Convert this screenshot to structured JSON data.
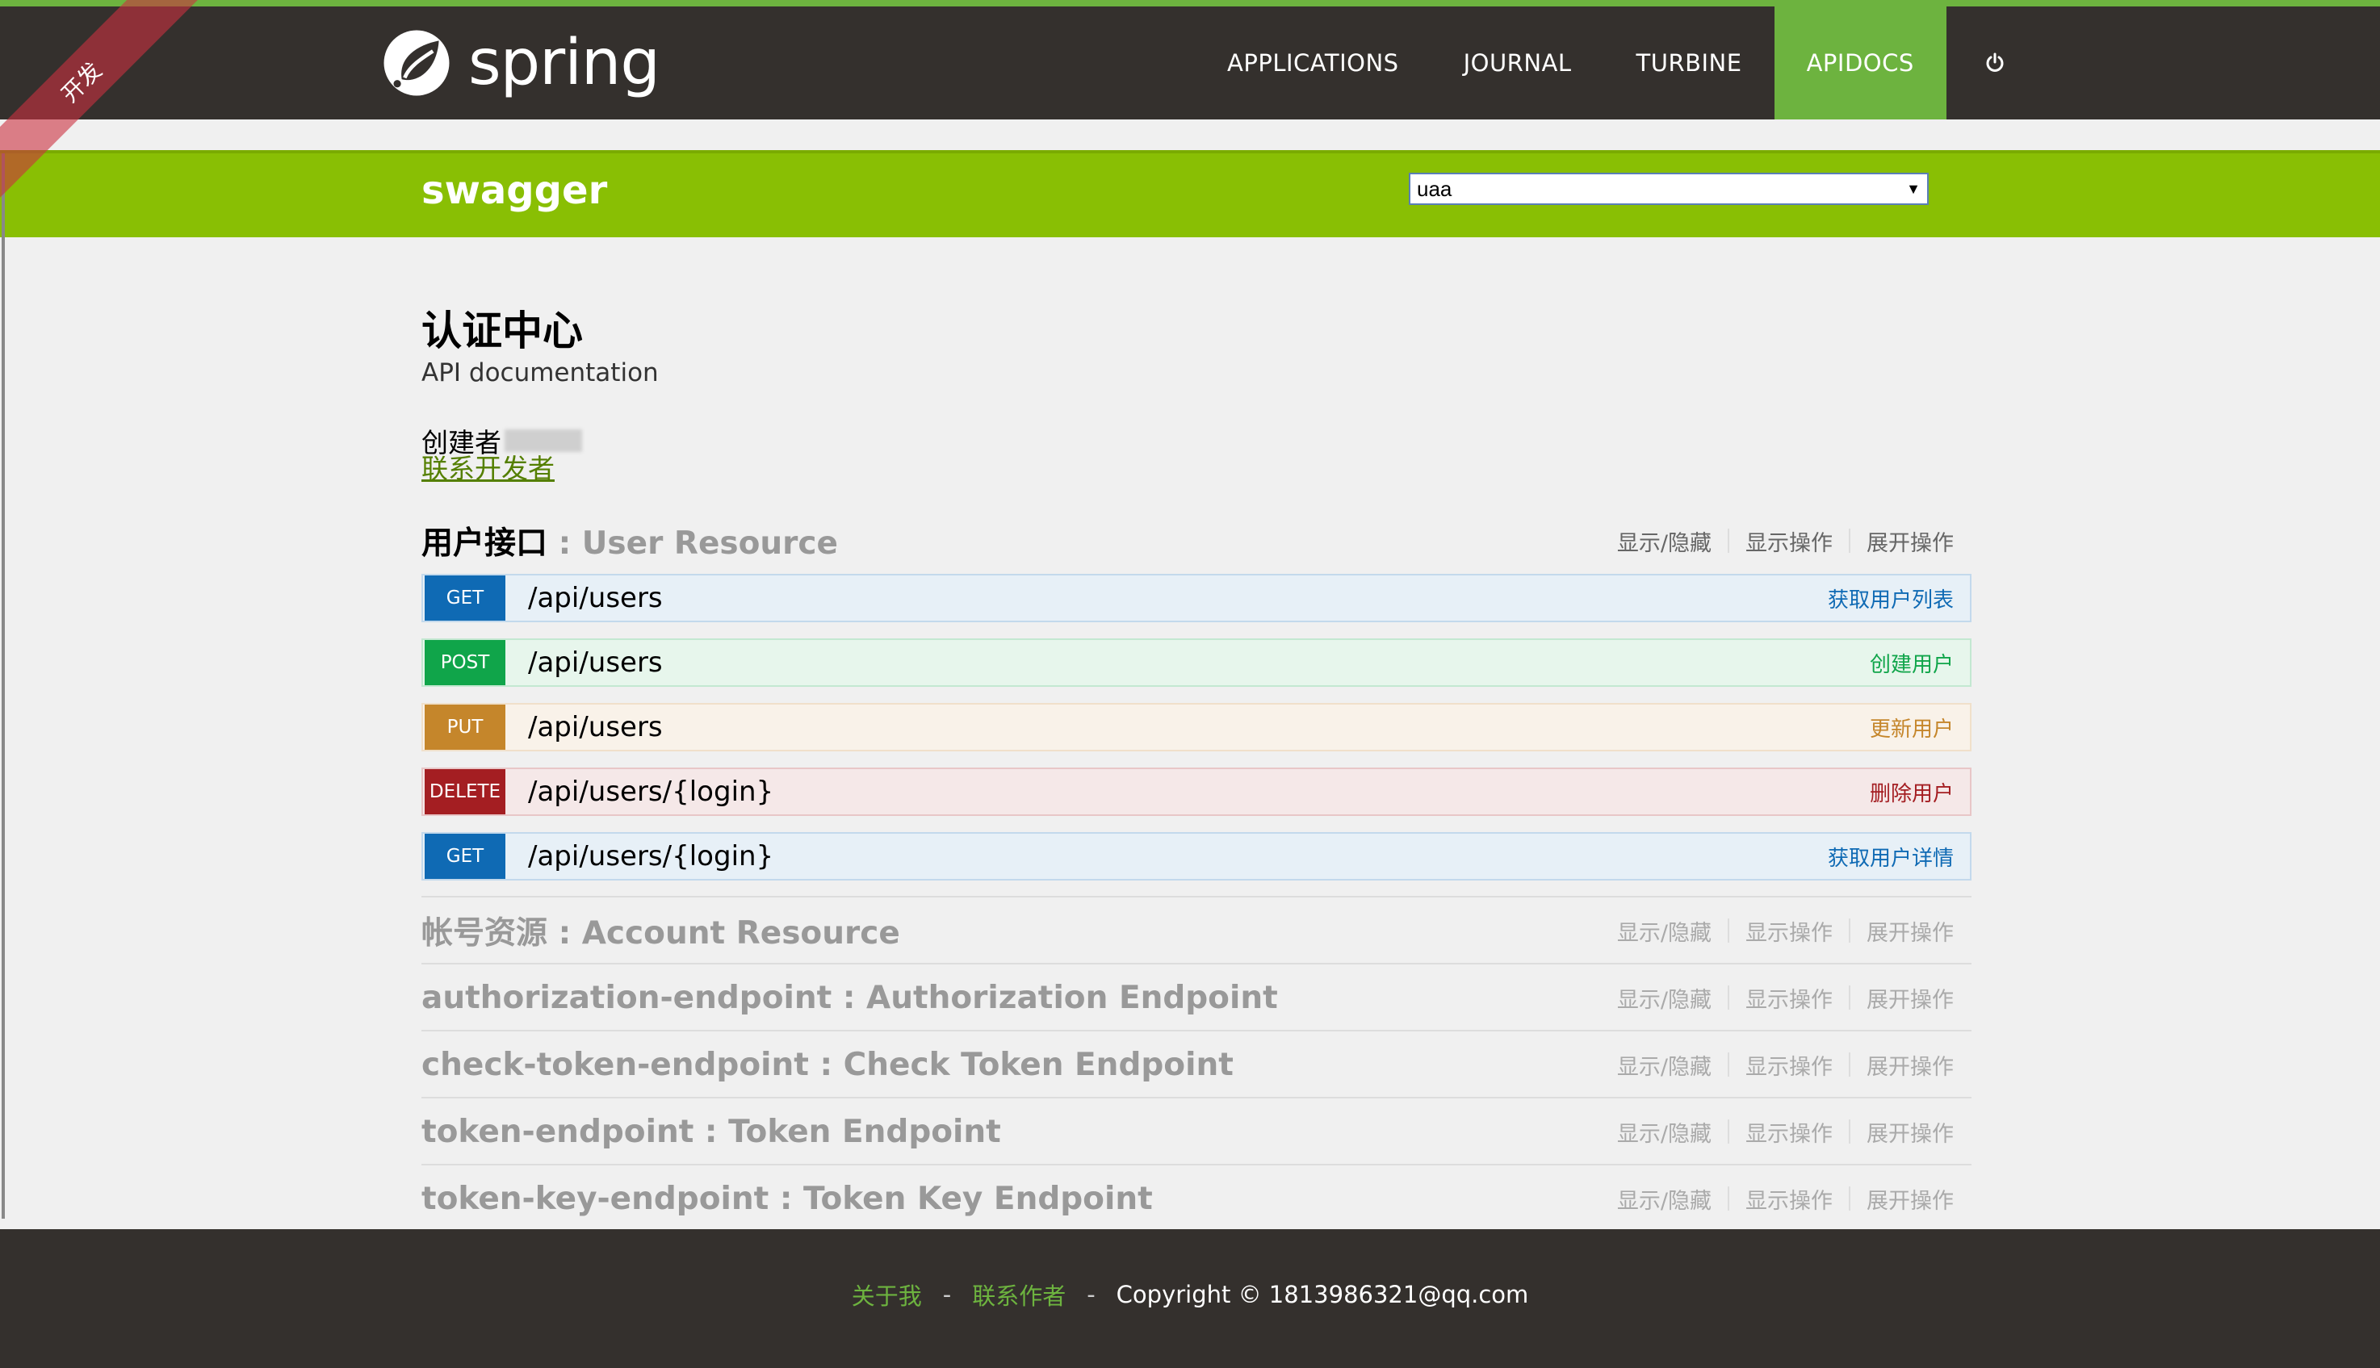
{
  "brand": {
    "name": "spring"
  },
  "nav": {
    "items": [
      "APPLICATIONS",
      "JOURNAL",
      "TURBINE",
      "APIDOCS"
    ],
    "active": "APIDOCS",
    "power_icon": "power-icon"
  },
  "ribbon": {
    "label": "开发"
  },
  "swagger": {
    "logo": "swagger",
    "selected_spec": "uaa"
  },
  "info": {
    "title": "认证中心",
    "description": "API documentation",
    "creator_label": "创建者",
    "contact_link": "联系开发者"
  },
  "resource_actions": {
    "toggle": "显示/隐藏",
    "list": "显示操作",
    "expand": "展开操作"
  },
  "user_resource": {
    "name_cn": "用户接口",
    "name_en": ": User Resource",
    "operations": [
      {
        "method": "GET",
        "path": "/api/users",
        "summary": "获取用户列表"
      },
      {
        "method": "POST",
        "path": "/api/users",
        "summary": "创建用户"
      },
      {
        "method": "PUT",
        "path": "/api/users",
        "summary": "更新用户"
      },
      {
        "method": "DELETE",
        "path": "/api/users/{login}",
        "summary": "删除用户"
      },
      {
        "method": "GET",
        "path": "/api/users/{login}",
        "summary": "获取用户详情"
      }
    ]
  },
  "collapsed_resources": [
    {
      "name": "帐号资源 : Account Resource"
    },
    {
      "name": "authorization-endpoint : Authorization Endpoint"
    },
    {
      "name": "check-token-endpoint : Check Token Endpoint"
    },
    {
      "name": "token-endpoint : Token Endpoint"
    },
    {
      "name": "token-key-endpoint : Token Key Endpoint"
    }
  ],
  "footer": {
    "about": "关于我",
    "contact": "联系作者",
    "separator": "-",
    "copyright": "Copyright © 1813986321@qq.com"
  },
  "colors": {
    "spring_green": "#6db33f",
    "swagger_green": "#89bf04",
    "navbar": "#34302d"
  }
}
